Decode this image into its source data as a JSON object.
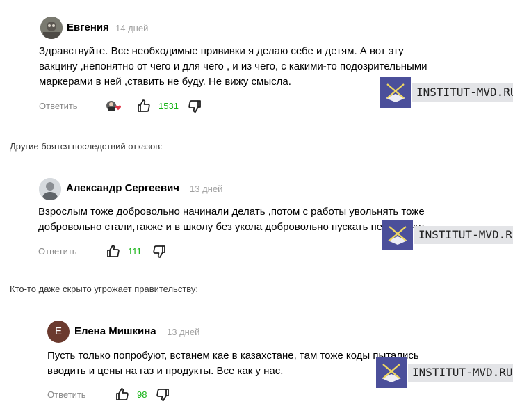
{
  "comments": [
    {
      "author": "Евгения",
      "date": "14 дней",
      "text": "Здравствуйте. Все необходимые прививки я делаю себе и детям. А вот эту вакцину ,непонятно от чего и для чего , и из чего, с какими-то подозрительными маркерами в ней ,ставить не буду. Не вижу смысла.",
      "reply_label": "Ответить",
      "likes": "1531"
    },
    {
      "author": "Александр Сергеевич",
      "date": "13 дней",
      "text": "Взрослым тоже добровольно начинали делать ,потом с работы увольнять тоже добровольно стали,также и в школу без укола добровольно пускать перестанут.",
      "reply_label": "Ответить",
      "likes": "111"
    },
    {
      "author": "Елена Мишкина",
      "avatar_letter": "Е",
      "date": "13 дней",
      "text": "Пусть только попробуют, встанем кае в казахстане, там тоже коды пытались вводить и цены на газ и продукты. Все как у нас.",
      "reply_label": "Ответить",
      "likes": "98"
    }
  ],
  "captions": {
    "first": "Другие боятся последствий отказов:",
    "second": "Кто-то даже скрыто угрожает правительству:"
  },
  "watermark": {
    "text": "INSTITUT-MVD.RU"
  },
  "colors": {
    "likes_green": "#17b317",
    "muted_gray": "#888888",
    "watermark_bg": "#4b4f9a"
  },
  "icons": [
    "thumb-up-icon",
    "thumb-down-icon",
    "reaction-avatars-icon",
    "heart-icon"
  ]
}
